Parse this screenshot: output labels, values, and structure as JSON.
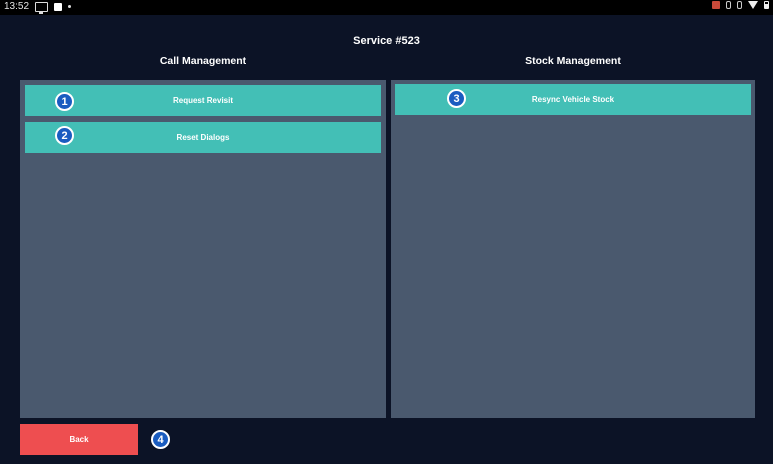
{
  "status_bar": {
    "time": "13:52",
    "icons": [
      "cast-icon",
      "square-icon",
      "dot-icon",
      "app-notification-icon",
      "bluetooth-icon",
      "location-icon",
      "wifi-icon",
      "battery-icon"
    ]
  },
  "page": {
    "title": "Service #523"
  },
  "call_management": {
    "header": "Call Management",
    "buttons": [
      {
        "label": "Request Revisit",
        "badge": "1"
      },
      {
        "label": "Reset Dialogs",
        "badge": "2"
      }
    ]
  },
  "stock_management": {
    "header": "Stock Management",
    "buttons": [
      {
        "label": "Resync Vehicle Stock",
        "badge": "3"
      }
    ]
  },
  "footer": {
    "back_label": "Back",
    "back_badge": "4"
  },
  "colors": {
    "background": "#0c1326",
    "panel": "#4a596e",
    "action_button": "#43bfb6",
    "back_button": "#ee4e50",
    "badge": "#1a5cc0"
  }
}
